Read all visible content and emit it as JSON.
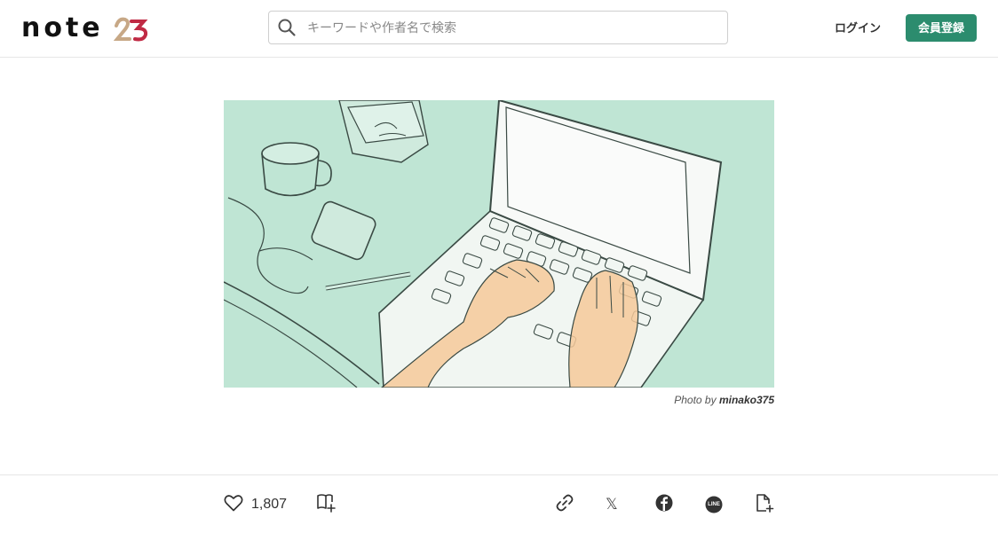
{
  "header": {
    "logo": {
      "text": "note",
      "year_badge": "23"
    },
    "search": {
      "placeholder": "キーワードや作者名で検索",
      "value": ""
    },
    "login_label": "ログイン",
    "signup_label": "会員登録",
    "brand_color": "#2c8c6e"
  },
  "hero": {
    "illustration": "laptop-typing-illustration",
    "background_color": "#bfe5d4",
    "credit_prefix": "Photo by",
    "credit_author": "minako375"
  },
  "actions": {
    "like_count": "1,807",
    "icons": [
      "heart-icon",
      "magazine-add-icon",
      "link-icon",
      "x-icon",
      "facebook-icon",
      "line-icon",
      "note-add-icon"
    ],
    "line_label": "LINE",
    "x_label": "𝕏"
  }
}
